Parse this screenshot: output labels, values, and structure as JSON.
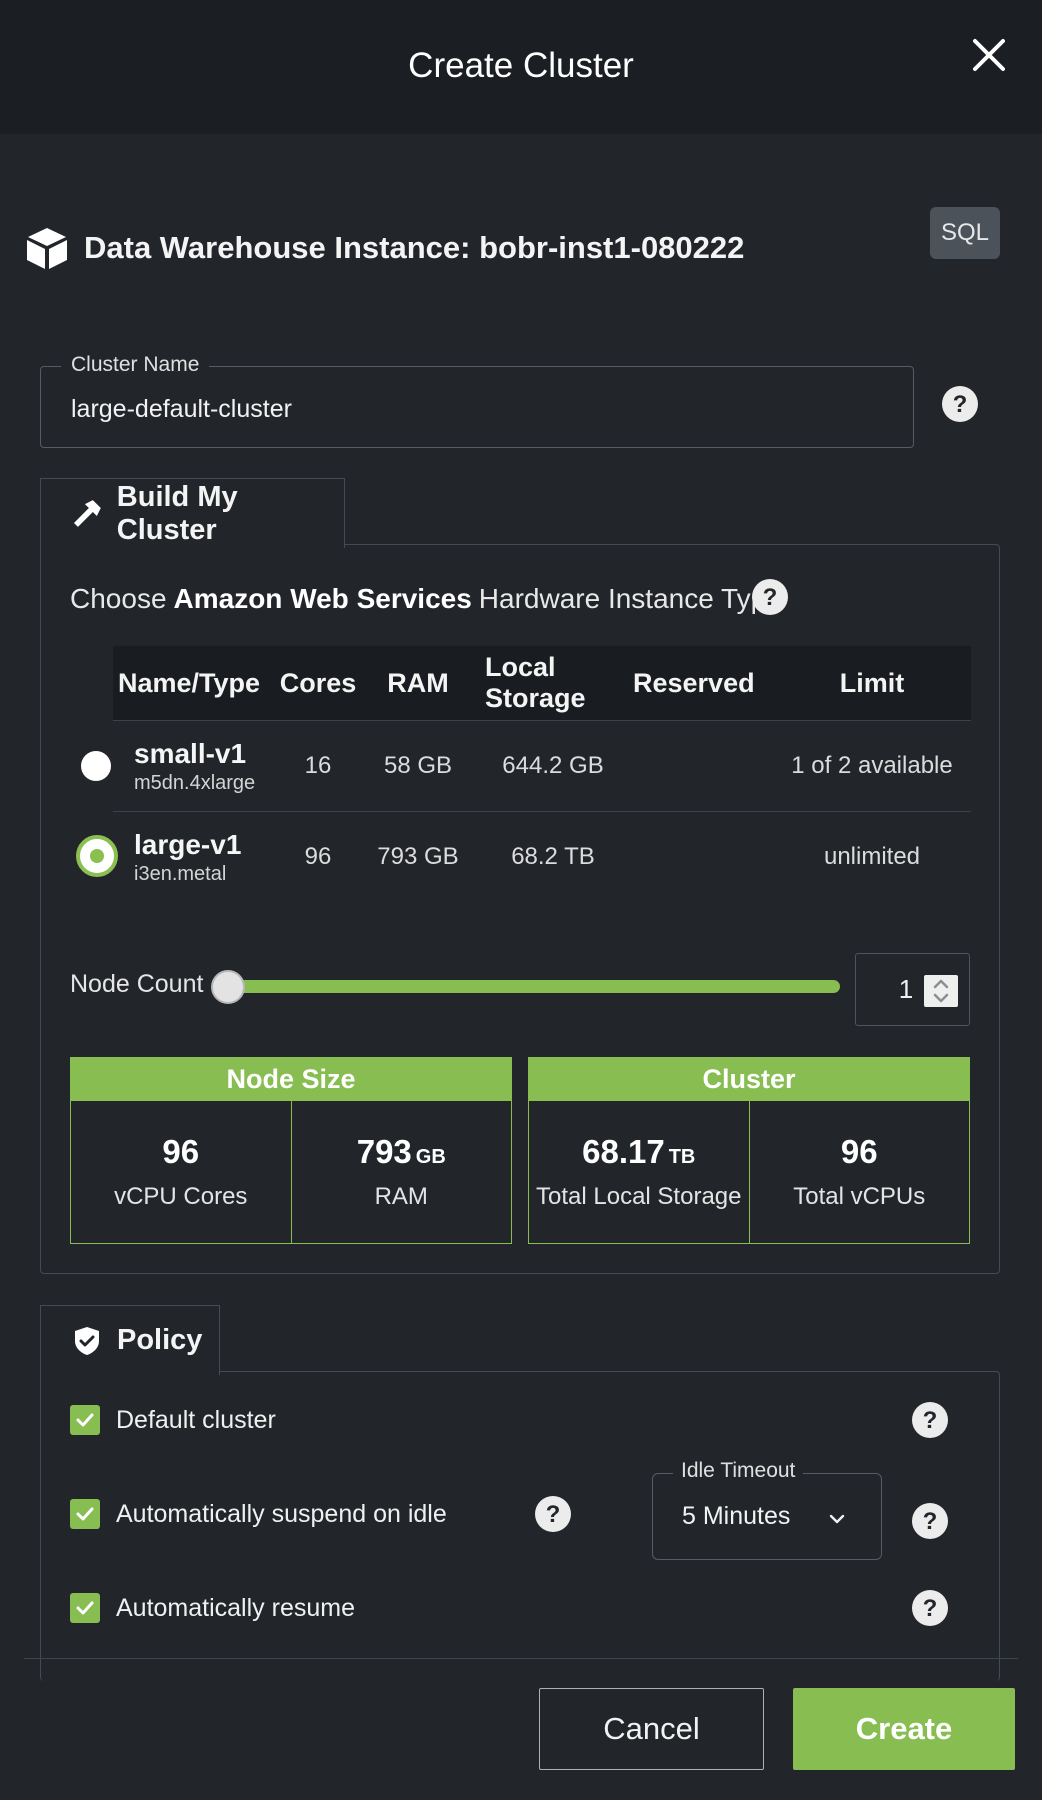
{
  "header": {
    "title": "Create Cluster"
  },
  "instance": {
    "title": "Data Warehouse Instance: bobr-inst1-080222",
    "badge": "SQL"
  },
  "cluster_name": {
    "label": "Cluster Name",
    "value": "large-default-cluster"
  },
  "build": {
    "tab_label": "Build My Cluster",
    "choose_prefix": "Choose",
    "choose_provider": "Amazon Web Services",
    "choose_suffix": "Hardware Instance Type",
    "columns": [
      "Name/Type",
      "Cores",
      "RAM",
      "Local Storage",
      "Reserved",
      "Limit"
    ],
    "rows": [
      {
        "name": "small-v1",
        "type": "m5dn.4xlarge",
        "cores": "16",
        "ram": "58 GB",
        "storage": "644.2 GB",
        "reserved": "",
        "limit": "1 of 2 available",
        "selected": false
      },
      {
        "name": "large-v1",
        "type": "i3en.metal",
        "cores": "96",
        "ram": "793 GB",
        "storage": "68.2 TB",
        "reserved": "",
        "limit": "unlimited",
        "selected": true
      }
    ],
    "node_count": {
      "label": "Node Count",
      "value": "1",
      "slider_fraction": 1.0
    },
    "node_size": {
      "title": "Node Size",
      "cores_value": "96",
      "cores_label": "vCPU Cores",
      "ram_value": "793",
      "ram_unit": "GB",
      "ram_label": "RAM"
    },
    "cluster": {
      "title": "Cluster",
      "storage_value": "68.17",
      "storage_unit": "TB",
      "storage_label": "Total Local Storage",
      "vcpu_value": "96",
      "vcpu_label": "Total vCPUs"
    }
  },
  "policy": {
    "tab_label": "Policy",
    "default_cluster": "Default cluster",
    "auto_suspend": "Automatically suspend on idle",
    "auto_resume": "Automatically resume",
    "idle_timeout": {
      "label": "Idle Timeout",
      "value": "5 Minutes"
    }
  },
  "footer": {
    "cancel_label": "Cancel",
    "create_label": "Create"
  },
  "colors": {
    "accent": "#88bd51",
    "background": "#22262b",
    "header": "#1b1e22"
  }
}
